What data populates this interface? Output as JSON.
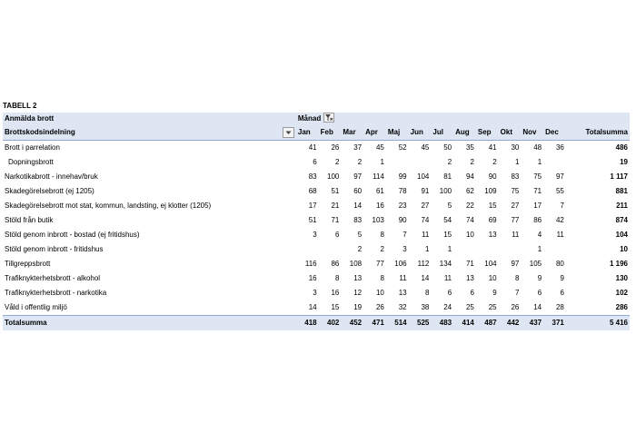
{
  "title": "TABELL 2",
  "header": {
    "row_label_title": "Anmälda brott",
    "column_field": "Månad",
    "row_field": "Brottskodsindelning",
    "total_label": "Totalsumma"
  },
  "months": [
    "Jan",
    "Feb",
    "Mar",
    "Apr",
    "Maj",
    "Jun",
    "Jul",
    "Aug",
    "Sep",
    "Okt",
    "Nov",
    "Dec"
  ],
  "rows": [
    {
      "label": "Brott i parrelation",
      "values": [
        "41",
        "26",
        "37",
        "45",
        "52",
        "45",
        "50",
        "35",
        "41",
        "30",
        "48",
        "36"
      ],
      "total": "486"
    },
    {
      "label": "Dopningsbrott",
      "values": [
        "6",
        "2",
        "2",
        "1",
        "",
        "",
        "2",
        "2",
        "2",
        "1",
        "1",
        ""
      ],
      "total": "19"
    },
    {
      "label": "Narkotikabrott - innehav/bruk",
      "values": [
        "83",
        "100",
        "97",
        "114",
        "99",
        "104",
        "81",
        "94",
        "90",
        "83",
        "75",
        "97"
      ],
      "total": "1 117"
    },
    {
      "label": "Skadegörelsebrott (ej 1205)",
      "values": [
        "68",
        "51",
        "60",
        "61",
        "78",
        "91",
        "100",
        "62",
        "109",
        "75",
        "71",
        "55"
      ],
      "total": "881"
    },
    {
      "label": "Skadegörelsebrott mot stat, kommun, landsting, ej klotter (1205)",
      "values": [
        "17",
        "21",
        "14",
        "16",
        "23",
        "27",
        "5",
        "22",
        "15",
        "27",
        "17",
        "7"
      ],
      "total": "211"
    },
    {
      "label": "Stöld från butik",
      "values": [
        "51",
        "71",
        "83",
        "103",
        "90",
        "74",
        "54",
        "74",
        "69",
        "77",
        "86",
        "42"
      ],
      "total": "874"
    },
    {
      "label": "Stöld genom inbrott - bostad (ej fritidshus)",
      "values": [
        "3",
        "6",
        "5",
        "8",
        "7",
        "11",
        "15",
        "10",
        "13",
        "11",
        "4",
        "11"
      ],
      "total": "104"
    },
    {
      "label": "Stöld genom inbrott - fritidshus",
      "values": [
        "",
        "",
        "2",
        "2",
        "3",
        "1",
        "1",
        "",
        "",
        "",
        "1",
        ""
      ],
      "total": "10"
    },
    {
      "label": "Tillgreppsbrott",
      "values": [
        "116",
        "86",
        "108",
        "77",
        "106",
        "112",
        "134",
        "71",
        "104",
        "97",
        "105",
        "80"
      ],
      "total": "1 196"
    },
    {
      "label": "Trafiknykterhetsbrott - alkohol",
      "values": [
        "16",
        "8",
        "13",
        "8",
        "11",
        "14",
        "11",
        "13",
        "10",
        "8",
        "9",
        "9"
      ],
      "total": "130"
    },
    {
      "label": "Trafiknykterhetsbrott - narkotika",
      "values": [
        "3",
        "16",
        "12",
        "10",
        "13",
        "8",
        "6",
        "6",
        "9",
        "7",
        "6",
        "6"
      ],
      "total": "102"
    },
    {
      "label": "Våld i offentlig miljö",
      "values": [
        "14",
        "15",
        "19",
        "26",
        "32",
        "38",
        "24",
        "25",
        "25",
        "26",
        "14",
        "28"
      ],
      "total": "286"
    }
  ],
  "totals": {
    "label": "Totalsumma",
    "values": [
      "418",
      "402",
      "452",
      "471",
      "514",
      "525",
      "483",
      "414",
      "487",
      "442",
      "437",
      "371"
    ],
    "grand_total": "5 416"
  }
}
